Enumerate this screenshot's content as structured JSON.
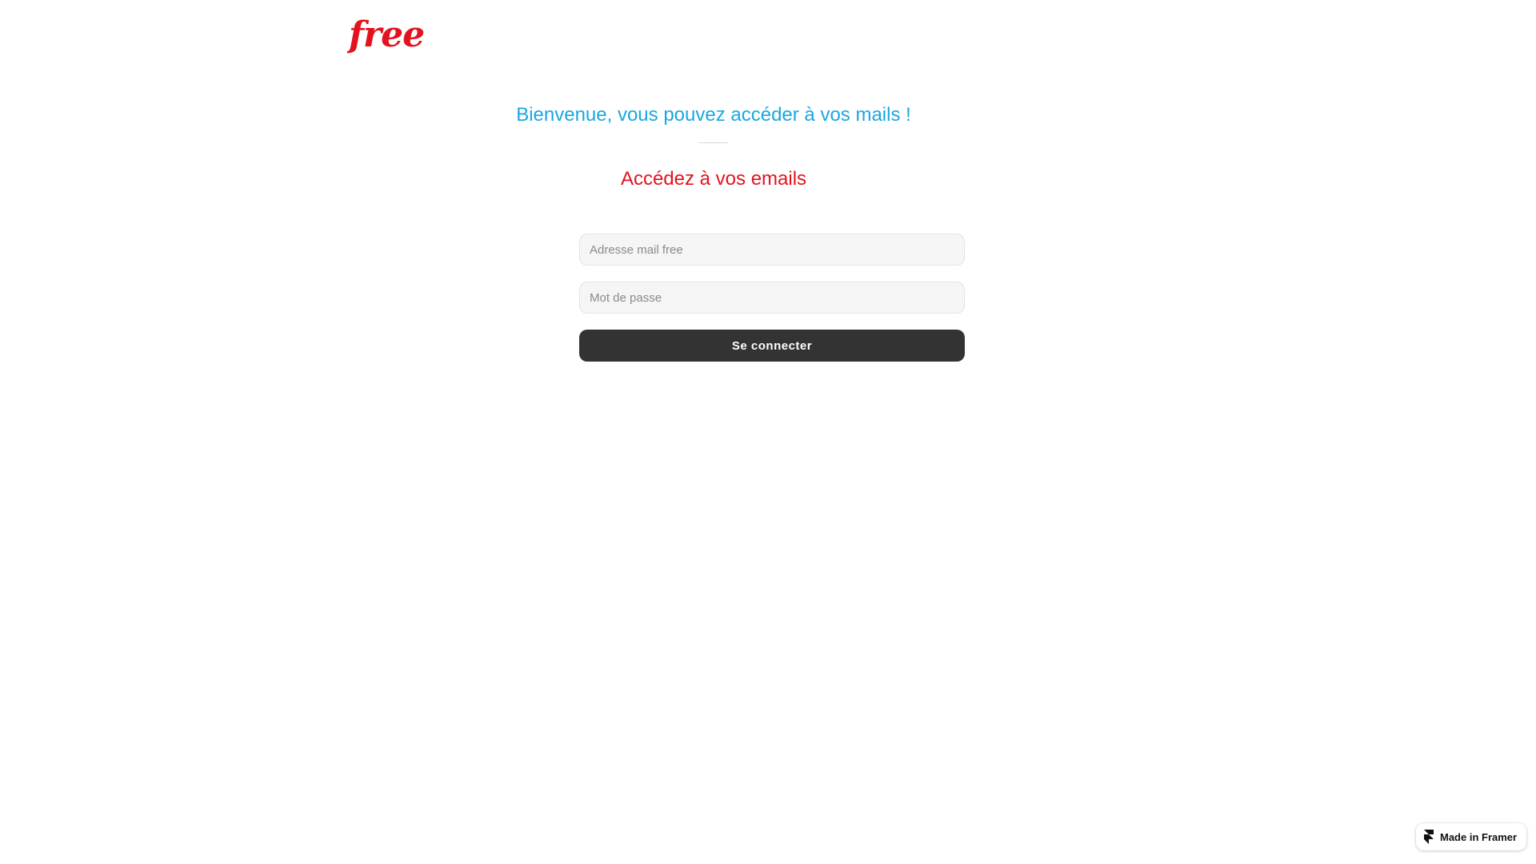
{
  "brand": {
    "logo_text": "free",
    "logo_color": "#e2131f"
  },
  "header": {
    "welcome": "Bienvenue, vous pouvez accéder à vos mails !",
    "welcome_color": "#1aa7e0",
    "subtitle": "Accédez à vos emails",
    "subtitle_color": "#e2131f"
  },
  "form": {
    "email_placeholder": "Adresse mail free",
    "email_value": "",
    "password_placeholder": "Mot de passe",
    "password_value": "",
    "submit_label": "Se connecter",
    "submit_color": "#333333"
  },
  "badge": {
    "label": "Made in Framer",
    "icon": "framer-icon"
  }
}
